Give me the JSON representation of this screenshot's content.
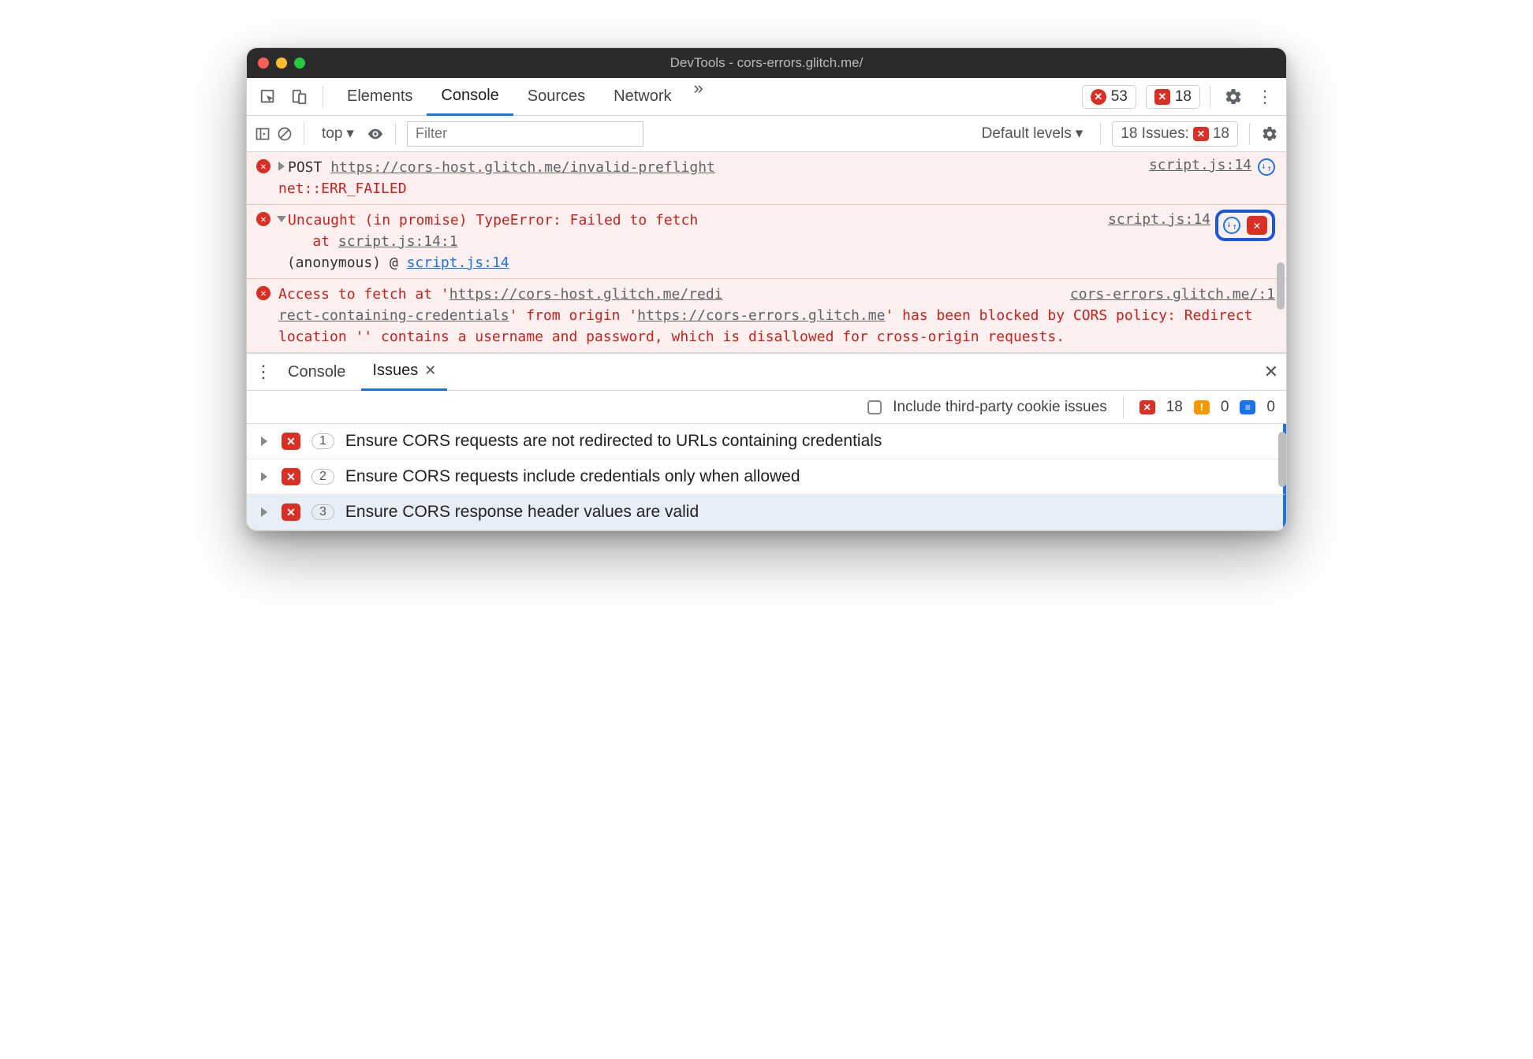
{
  "window": {
    "title": "DevTools - cors-errors.glitch.me/"
  },
  "tabs": {
    "elements": "Elements",
    "console": "Console",
    "sources": "Sources",
    "network": "Network",
    "more": "»"
  },
  "counters": {
    "errors": "53",
    "issues": "18"
  },
  "toolbar": {
    "context": "top",
    "filter_placeholder": "Filter",
    "levels": "Default levels",
    "issues_label": "18 Issues:",
    "issues_count": "18"
  },
  "console": {
    "m1": {
      "method": "POST",
      "url": "https://cors-host.glitch.me/invalid-preflight",
      "status": "net::ERR_FAILED",
      "src": "script.js:14"
    },
    "m2": {
      "text": "Uncaught (in promise) TypeError: Failed to fetch",
      "at": "at ",
      "loc": "script.js:14:1",
      "anon": "(anonymous) @",
      "anon_link": "script.js:14",
      "src": "script.js:14"
    },
    "m3": {
      "p1": "Access to fetch at '",
      "url1a": "https://cors-host.glitch.me/redi",
      "url1b": "rect-containing-credentials",
      "p2": "' from origin '",
      "url2": "https://cors-errors.glitch.me",
      "p3": "' has been blocked by CORS policy: Redirect location '' contains a username and password, which is disallowed for cross-origin requests.",
      "src": "cors-errors.glitch.me/:1"
    }
  },
  "drawer": {
    "console_tab": "Console",
    "issues_tab": "Issues",
    "include_label": "Include third-party cookie issues",
    "counts": {
      "errors": "18",
      "warnings": "0",
      "info": "0"
    },
    "rows": [
      {
        "count": "1",
        "text": "Ensure CORS requests are not redirected to URLs containing credentials"
      },
      {
        "count": "2",
        "text": "Ensure CORS requests include credentials only when allowed"
      },
      {
        "count": "3",
        "text": "Ensure CORS response header values are valid"
      }
    ]
  }
}
